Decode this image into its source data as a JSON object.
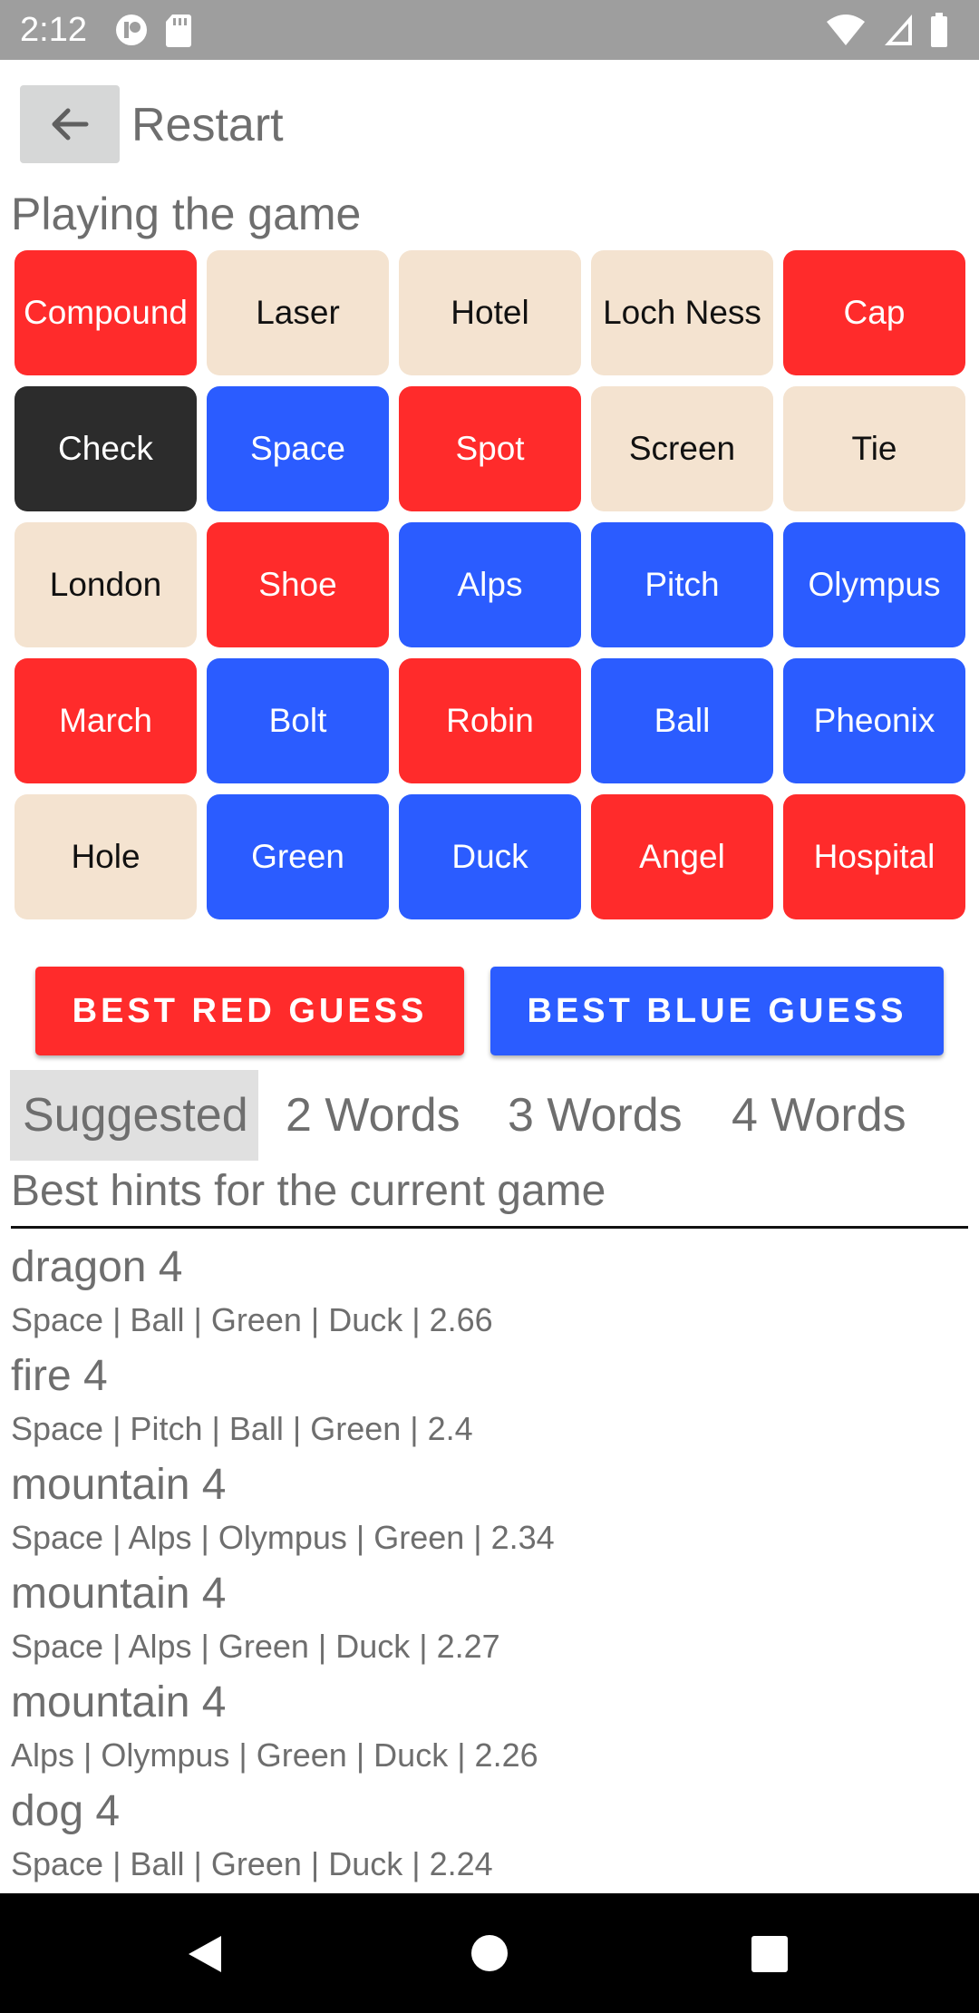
{
  "status_bar": {
    "time": "2:12",
    "icons_left": [
      "game-controller-icon",
      "sd-card-icon"
    ],
    "icons_right": [
      "wifi-icon",
      "signal-icon",
      "battery-icon"
    ]
  },
  "toolbar": {
    "back_icon": "arrow-left-icon",
    "title": "Restart"
  },
  "page": {
    "section_title": "Playing the game"
  },
  "colors": {
    "red": "#ff2b2b",
    "blue": "#2b5cff",
    "neutral": "#f4e3d0",
    "assassin": "#2c2c2c"
  },
  "board": {
    "cards": [
      {
        "word": "Compound",
        "team": "red"
      },
      {
        "word": "Laser",
        "team": "neutral"
      },
      {
        "word": "Hotel",
        "team": "neutral"
      },
      {
        "word": "Loch Ness",
        "team": "neutral"
      },
      {
        "word": "Cap",
        "team": "red"
      },
      {
        "word": "Check",
        "team": "assassin"
      },
      {
        "word": "Space",
        "team": "blue"
      },
      {
        "word": "Spot",
        "team": "red"
      },
      {
        "word": "Screen",
        "team": "neutral"
      },
      {
        "word": "Tie",
        "team": "neutral"
      },
      {
        "word": "London",
        "team": "neutral"
      },
      {
        "word": "Shoe",
        "team": "red"
      },
      {
        "word": "Alps",
        "team": "blue"
      },
      {
        "word": "Pitch",
        "team": "blue"
      },
      {
        "word": "Olympus",
        "team": "blue"
      },
      {
        "word": "March",
        "team": "red"
      },
      {
        "word": "Bolt",
        "team": "blue"
      },
      {
        "word": "Robin",
        "team": "red"
      },
      {
        "word": "Ball",
        "team": "blue"
      },
      {
        "word": "Pheonix",
        "team": "blue"
      },
      {
        "word": "Hole",
        "team": "neutral"
      },
      {
        "word": "Green",
        "team": "blue"
      },
      {
        "word": "Duck",
        "team": "blue"
      },
      {
        "word": "Angel",
        "team": "red"
      },
      {
        "word": "Hospital",
        "team": "red"
      }
    ]
  },
  "buttons": {
    "best_red": "BEST RED GUESS",
    "best_blue": "BEST BLUE GUESS"
  },
  "tabs": [
    {
      "label": "Suggested",
      "active": true
    },
    {
      "label": "2 Words",
      "active": false
    },
    {
      "label": "3 Words",
      "active": false
    },
    {
      "label": "4 Words",
      "active": false
    }
  ],
  "hints": {
    "header": "Best hints for the current game",
    "items": [
      {
        "word": "dragon 4",
        "detail": "Space | Ball | Green | Duck | 2.66"
      },
      {
        "word": "fire 4",
        "detail": "Space | Pitch | Ball | Green | 2.4"
      },
      {
        "word": "mountain 4",
        "detail": "Space | Alps | Olympus | Green | 2.34"
      },
      {
        "word": "mountain 4",
        "detail": "Space | Alps | Green | Duck | 2.27"
      },
      {
        "word": "mountain 4",
        "detail": "Alps | Olympus | Green | Duck | 2.26"
      },
      {
        "word": "dog 4",
        "detail": "Space | Ball | Green | Duck | 2.24"
      }
    ]
  },
  "nav_bar": {
    "back_icon": "triangle-back-icon",
    "home_icon": "circle-home-icon",
    "recents_icon": "square-recents-icon"
  }
}
